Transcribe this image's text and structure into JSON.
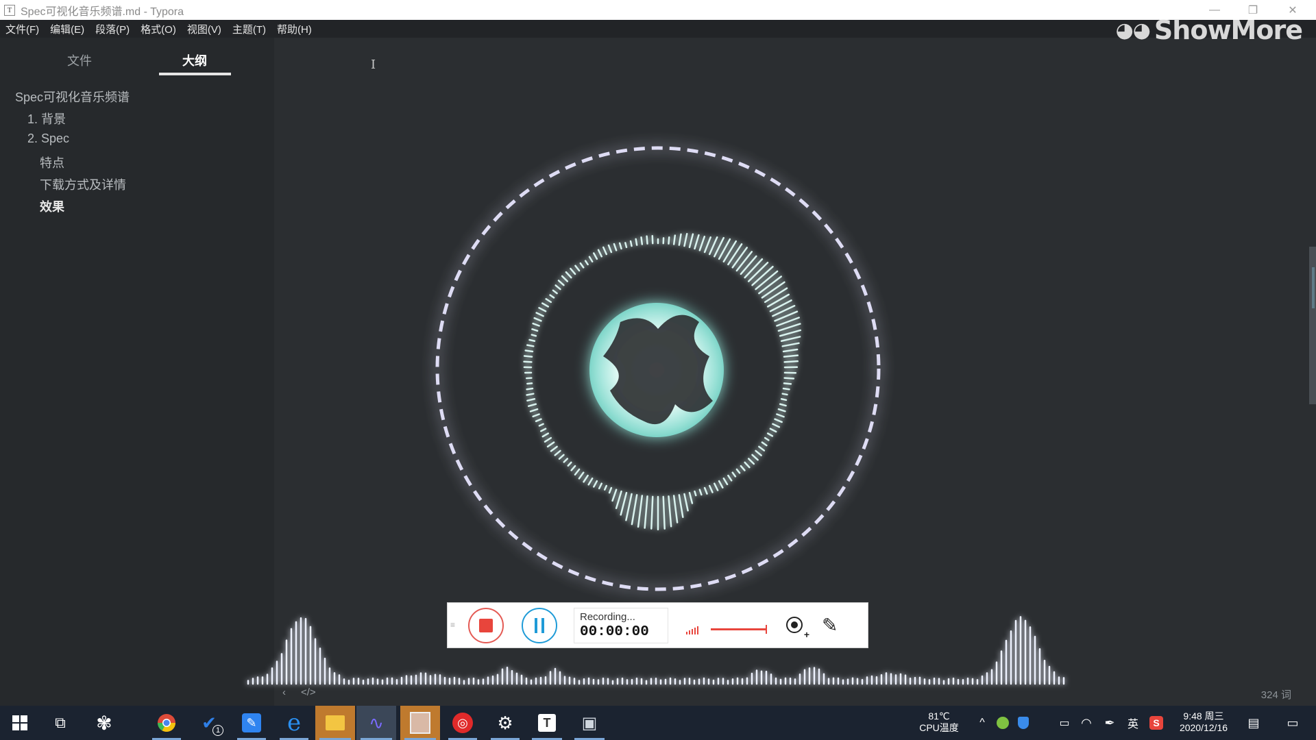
{
  "window": {
    "title": "Spec可视化音乐频谱.md - Typora",
    "app_icon": "T"
  },
  "window_controls": {
    "minimize": "—",
    "restore": "❐",
    "close": "✕"
  },
  "menu": [
    "文件(F)",
    "编辑(E)",
    "段落(P)",
    "格式(O)",
    "视图(V)",
    "主题(T)",
    "帮助(H)"
  ],
  "watermark": "ShowMore",
  "sidebar": {
    "tabs": [
      "文件",
      "大纲"
    ],
    "active_tab": "大纲",
    "outline": [
      {
        "label": "Spec可视化音乐频谱",
        "level": 1
      },
      {
        "label": "1. 背景",
        "level": 2
      },
      {
        "label": "2. Spec",
        "level": 2
      },
      {
        "label": "特点",
        "level": 3
      },
      {
        "label": "下载方式及详情",
        "level": 3
      },
      {
        "label": "效果",
        "level": 3,
        "current": true
      }
    ]
  },
  "editor": {
    "footer_left_icons": [
      "‹",
      "</>"
    ],
    "word_count": "324 词"
  },
  "recorder": {
    "status_label": "Recording...",
    "time": "00:00:00",
    "colors": {
      "stop": "#e8453c",
      "pause": "#1f9bd7"
    }
  },
  "taskbar": {
    "cpu_temp": "81℃",
    "cpu_label": "CPU温度",
    "ime": "英",
    "time": "9:48 周三",
    "date": "2020/12/16",
    "todo_badge": "1",
    "typora_letter": "T"
  }
}
